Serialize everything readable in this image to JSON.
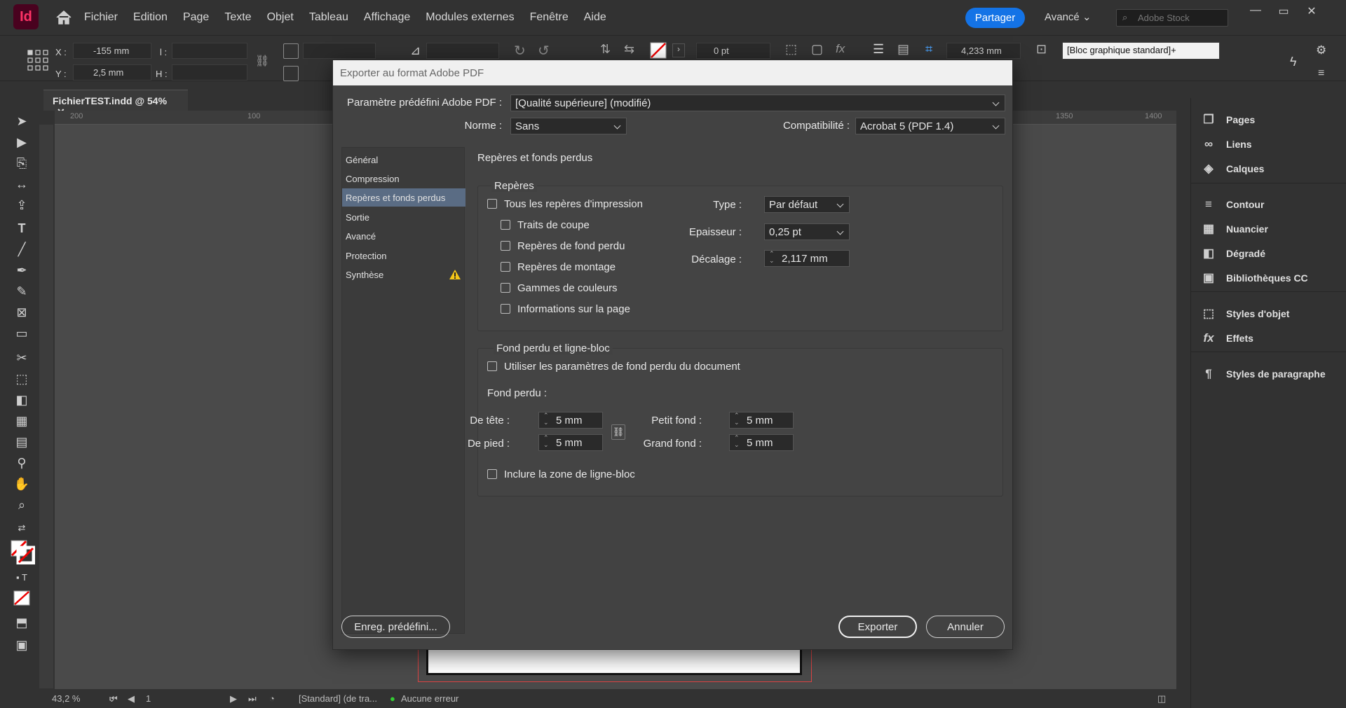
{
  "app": {
    "logo": "Id",
    "menus": [
      "Fichier",
      "Edition",
      "Page",
      "Texte",
      "Objet",
      "Tableau",
      "Affichage",
      "Modules externes",
      "Fenêtre",
      "Aide"
    ],
    "share_label": "Partager",
    "workspace_label": "Avancé",
    "stock_placeholder": "Adobe Stock"
  },
  "control": {
    "x_label": "X :",
    "x_value": "-155 mm",
    "y_label": "Y :",
    "y_value": "2,5 mm",
    "w_label": "l :",
    "h_label": "H :",
    "stroke_value": "0 pt",
    "size_value": "4,233 mm",
    "style_value": "[Bloc graphique standard]+"
  },
  "document": {
    "tab_label": "FichierTEST.indd @ 54%",
    "ruler_marks": [
      "200",
      "100",
      "1350",
      "1400"
    ],
    "zoom": "43,2 %",
    "page": "1",
    "preflight_profile": "[Standard] (de tra...",
    "preflight_status": "Aucune erreur"
  },
  "panels": [
    {
      "label": "Pages",
      "icon": "pages-icon"
    },
    {
      "label": "Liens",
      "icon": "links-icon"
    },
    {
      "label": "Calques",
      "icon": "layers-icon"
    },
    {
      "label": "Contour",
      "icon": "stroke-icon"
    },
    {
      "label": "Nuancier",
      "icon": "swatches-icon"
    },
    {
      "label": "Dégradé",
      "icon": "gradient-icon"
    },
    {
      "label": "Bibliothèques CC",
      "icon": "cc-libraries-icon"
    },
    {
      "label": "Styles d'objet",
      "icon": "object-styles-icon"
    },
    {
      "label": "Effets",
      "icon": "effects-icon"
    },
    {
      "label": "Styles de paragraphe",
      "icon": "paragraph-styles-icon"
    }
  ],
  "dialog": {
    "title": "Exporter au format Adobe PDF",
    "preset_label": "Paramètre prédéfini Adobe PDF :",
    "preset_value": "[Qualité supérieure] (modifié)",
    "standard_label": "Norme :",
    "standard_value": "Sans",
    "compat_label": "Compatibilité :",
    "compat_value": "Acrobat 5 (PDF 1.4)",
    "nav": [
      "Général",
      "Compression",
      "Repères et fonds perdus",
      "Sortie",
      "Avancé",
      "Protection",
      "Synthèse"
    ],
    "section_title": "Repères et fonds perdus",
    "marks": {
      "legend": "Repères",
      "all_marks": "Tous les repères d'impression",
      "crop": "Traits de coupe",
      "bleed": "Repères de fond perdu",
      "registration": "Repères de montage",
      "color_bars": "Gammes de couleurs",
      "page_info": "Informations sur la page",
      "type_label": "Type :",
      "type_value": "Par défaut",
      "weight_label": "Epaisseur :",
      "weight_value": "0,25 pt",
      "offset_label": "Décalage :",
      "offset_value": "2,117 mm"
    },
    "bleed": {
      "legend": "Fond perdu et ligne-bloc",
      "use_doc": "Utiliser les paramètres de fond perdu du document",
      "bleed_label": "Fond perdu :",
      "top_label": "De tête :",
      "top_value": "5 mm",
      "bottom_label": "De pied :",
      "bottom_value": "5 mm",
      "inside_label": "Petit fond :",
      "inside_value": "5 mm",
      "outside_label": "Grand fond :",
      "outside_value": "5 mm",
      "slug": "Inclure la zone de ligne-bloc"
    },
    "save_preset": "Enreg. prédéfini...",
    "export": "Exporter",
    "cancel": "Annuler"
  }
}
